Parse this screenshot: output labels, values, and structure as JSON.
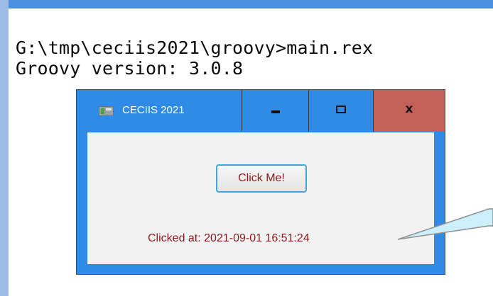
{
  "console": {
    "lines": [
      "G:\\tmp\\ceciis2021\\groovy>main.rex",
      "Groovy version: 3.0.8"
    ]
  },
  "app_window": {
    "icon": "app-window-icon",
    "title": "CECIIS 2021",
    "controls": {
      "minimize_icon": "minimize-icon",
      "maximize_icon": "maximize-icon",
      "close_label": "x",
      "close_color": "#c4605a"
    },
    "button_label": "Click Me!",
    "status_text": "Clicked at: 2021-09-01 16:51:24",
    "accent_color": "#2f8be6",
    "text_color": "#8b1a1a"
  },
  "callout": {
    "fill_color": "#cdeefb"
  }
}
